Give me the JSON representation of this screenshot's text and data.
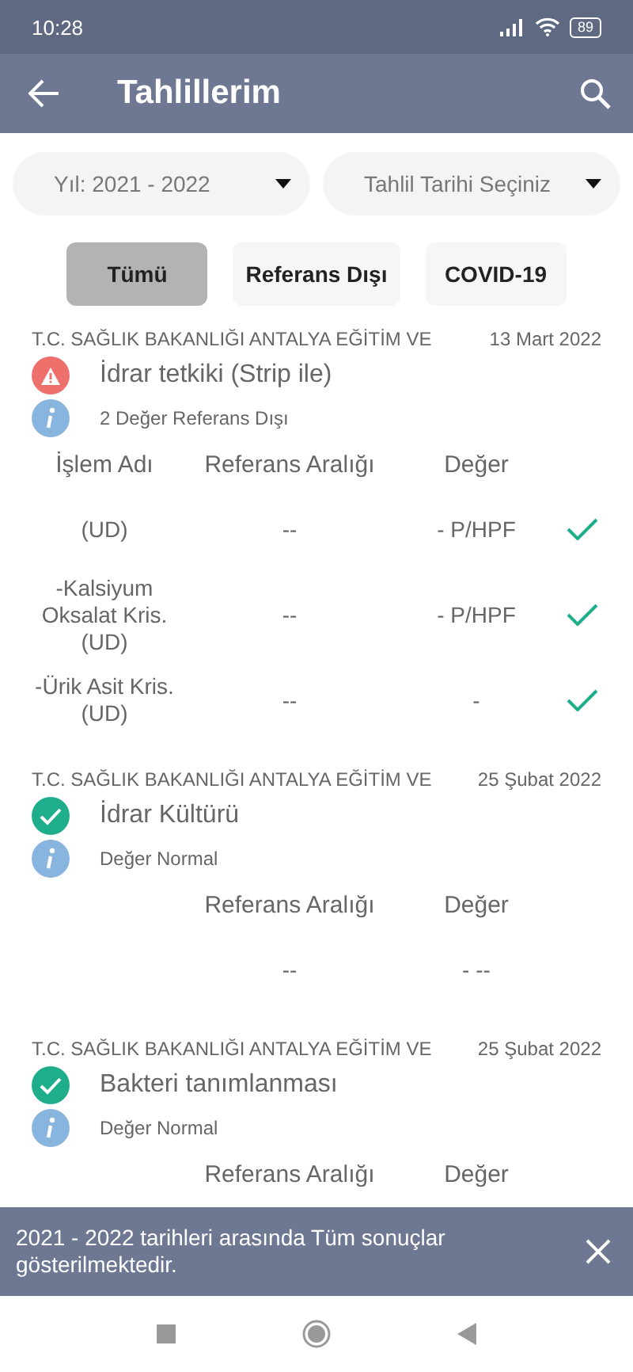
{
  "status_bar": {
    "time": "10:28",
    "battery": "89"
  },
  "app_bar": {
    "title": "Tahlillerim"
  },
  "dropdowns": [
    {
      "label": "Yıl: 2021 - 2022"
    },
    {
      "label": "Tahlil Tarihi Seçiniz"
    }
  ],
  "filters": [
    {
      "label": "Tümü",
      "selected": true
    },
    {
      "label": "Referans Dışı",
      "selected": false
    },
    {
      "label": "COVID-19",
      "selected": false
    }
  ],
  "results": [
    {
      "institution": "T.C. SAĞLIK BAKANLIĞI ANTALYA EĞİTİM VE",
      "date": "13 Mart 2022",
      "kind": "warning",
      "title": "İdrar tetkiki (Strip ile)",
      "info": "2 Değer Referans Dışı",
      "columns": {
        "name": "İşlem Adı",
        "reference": "Referans Aralığı",
        "value": "Değer"
      },
      "rows": [
        {
          "name": "(UD)",
          "reference": "--",
          "value": "- P/HPF",
          "checked": true
        },
        {
          "name": "-Kalsiyum Oksalat Kris. (UD)",
          "reference": "--",
          "value": "- P/HPF",
          "checked": true
        },
        {
          "name": "-Ürik Asit Kris. (UD)",
          "reference": "--",
          "value": "-",
          "checked": true
        }
      ]
    },
    {
      "institution": "T.C. SAĞLIK BAKANLIĞI ANTALYA EĞİTİM VE",
      "date": "25 Şubat 2022",
      "kind": "ok",
      "title": "İdrar Kültürü",
      "info": "Değer Normal",
      "columns": {
        "reference": "Referans Aralığı",
        "value": "Değer"
      },
      "rows": [
        {
          "reference": "--",
          "value": "- --",
          "checked": false
        }
      ]
    },
    {
      "institution": "T.C. SAĞLIK BAKANLIĞI ANTALYA EĞİTİM VE",
      "date": "25 Şubat 2022",
      "kind": "ok",
      "title": "Bakteri tanımlanması",
      "info": "Değer Normal",
      "columns": {
        "reference": "Referans Aralığı",
        "value": "Değer"
      }
    }
  ],
  "snackbar": {
    "message": "2021 - 2022 tarihleri arasında Tüm sonuçlar gösterilmektedir."
  }
}
